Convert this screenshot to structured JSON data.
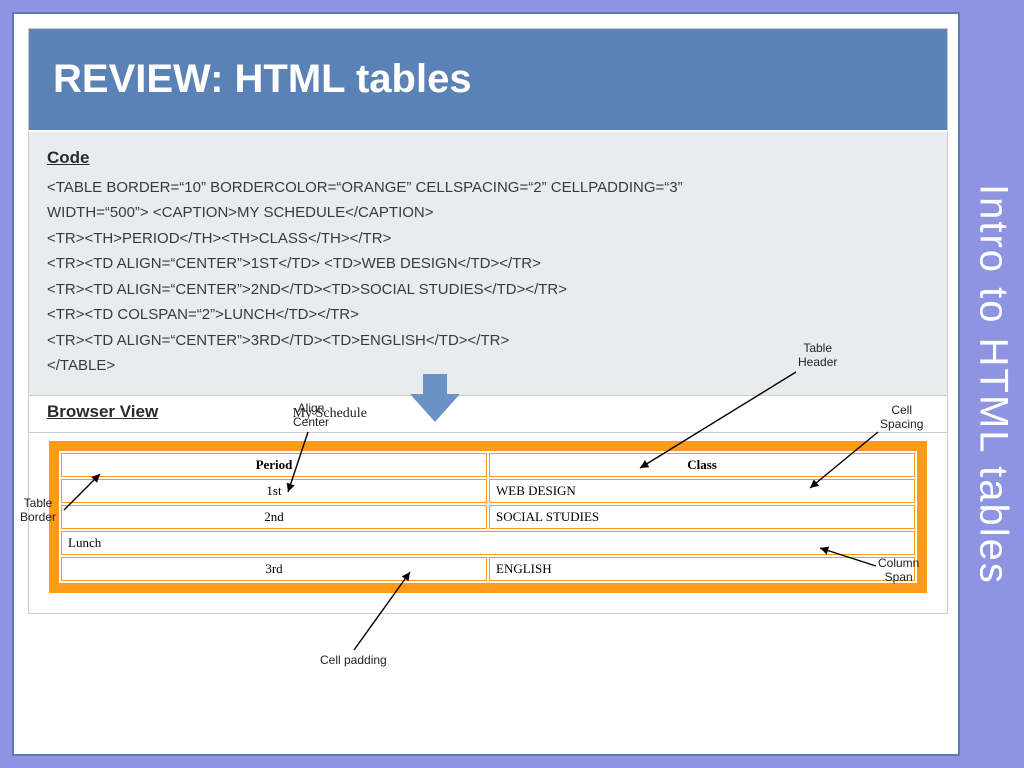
{
  "title": "REVIEW: HTML tables",
  "side_title": "Intro to HTML tables",
  "code": {
    "label": "Code",
    "line1": "<TABLE BORDER=“10” BORDERCOLOR=“ORANGE” CELLSPACING=“2” CELLPADDING=“3”",
    "line2": "WIDTH=“500”> <CAPTION>MY SCHEDULE</CAPTION>",
    "line3": "<TR><TH>PERIOD</TH><TH>CLASS</TH></TR>",
    "line4": "<TR><TD ALIGN=“CENTER”>1ST</TD> <TD>WEB DESIGN</TD></TR>",
    "line5": "<TR><TD ALIGN=“CENTER”>2ND</TD><TD>SOCIAL STUDIES</TD></TR>",
    "line6": "<TR><TD COLSPAN=“2”>LUNCH</TD></TR>",
    "line7": "<TR><TD ALIGN=“CENTER”>3RD</TD><TD>ENGLISH</TD></TR>",
    "line8": "</TABLE>"
  },
  "browser": {
    "label": "Browser View",
    "caption": "My Schedule",
    "headers": {
      "period": "Period",
      "class": "Class"
    },
    "rows": {
      "r1p": "1st",
      "r1c": "WEB DESIGN",
      "r2p": "2nd",
      "r2c": "SOCIAL STUDIES",
      "lunch": "Lunch",
      "r3p": "3rd",
      "r3c": "ENGLISH"
    }
  },
  "annot": {
    "align_center": "Align\nCenter",
    "table_header": "Table\nHeader",
    "cell_spacing": "Cell\nSpacing",
    "table_border": "Table\nBorder",
    "column_span": "Column\nSpan",
    "cell_padding": "Cell padding"
  }
}
